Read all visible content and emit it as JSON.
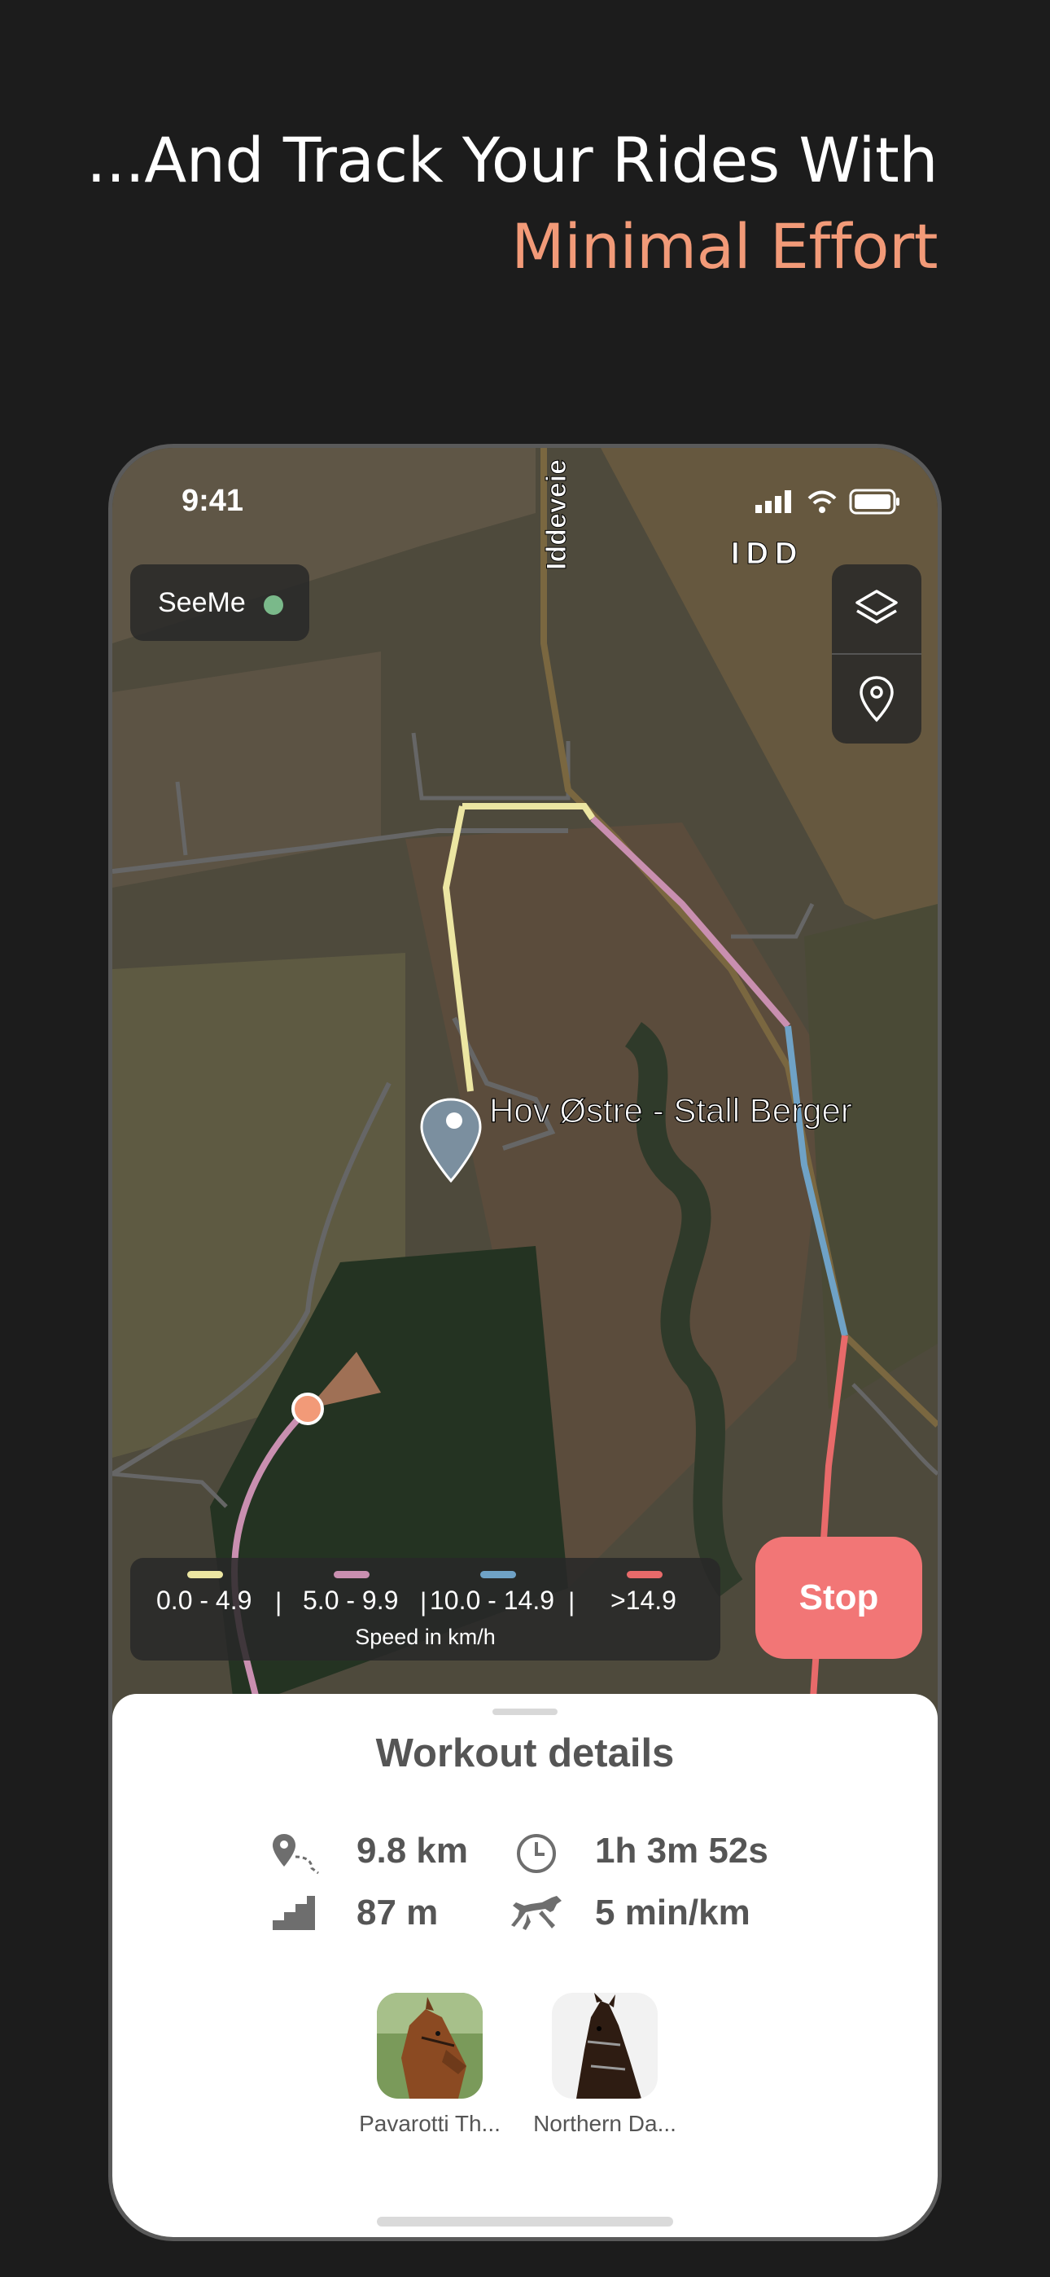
{
  "headline": {
    "line1": "...And Track Your Rides With",
    "line2": "Minimal Effort"
  },
  "status_bar": {
    "time": "9:41"
  },
  "map": {
    "road_label": "Iddeveie",
    "area_label": "IDD",
    "place_label": "Hov Østre - Stall Berger"
  },
  "seeme": {
    "label": "SeeMe",
    "status_color": "#7ab98a"
  },
  "map_controls": {
    "layers_icon": "layers-icon",
    "location_icon": "location-pin-icon"
  },
  "legend": {
    "ranges": [
      {
        "label": "0.0 - 4.9",
        "color": "#ece6a2"
      },
      {
        "label": "5.0 - 9.9",
        "color": "#c98fb0"
      },
      {
        "label": "10.0 - 14.9",
        "color": "#6fa2c6"
      },
      {
        "label": ">14.9",
        "color": "#e86a6a"
      }
    ],
    "unit_label": "Speed in km/h"
  },
  "stop_button": {
    "label": "Stop",
    "color": "#f27676"
  },
  "workout": {
    "title": "Workout details",
    "distance": "9.8 km",
    "duration": "1h 3m 52s",
    "elevation": "87 m",
    "pace": "5 min/km"
  },
  "horses": [
    {
      "name": "Pavarotti Th..."
    },
    {
      "name": "Northern Da..."
    }
  ],
  "colors": {
    "accent": "#f29a78",
    "background": "#1c1c1c"
  }
}
